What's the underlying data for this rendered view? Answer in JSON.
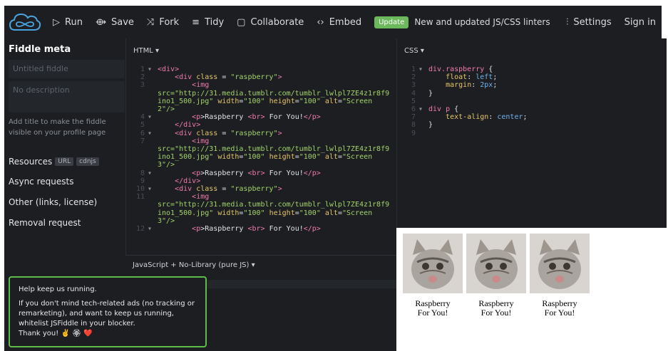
{
  "topbar": {
    "run": "Run",
    "save": "Save",
    "fork": "Fork",
    "tidy": "Tidy",
    "collaborate": "Collaborate",
    "embed": "Embed",
    "update_badge": "Update",
    "news": "New and updated JS/CSS linters",
    "settings": "Settings",
    "sign_in": "Sign in"
  },
  "sidebar": {
    "title": "Fiddle meta",
    "title_placeholder": "Untitled fiddle",
    "description_placeholder": "No description",
    "help": "Add title to make the fiddle visible on your profile page",
    "resources": "Resources",
    "resources_url": "URL",
    "resources_cdnjs": "cdnjs",
    "async": "Async requests",
    "other": "Other (links, license)",
    "removal": "Removal request"
  },
  "html_panel": {
    "header": "HTML ▾"
  },
  "css_panel": {
    "header": "CSS ▾"
  },
  "js_panel": {
    "header": "JavaScript + No-Library (pure JS) ▾"
  },
  "html_code": {
    "img_src_1": "src=\"http://31.media.tumblr.com/tumblr_lwlpl7ZE4z1r8f9",
    "img_src_2": "ino1_500.jpg\"",
    "caption": ">Raspberry ",
    "caption_2": " For You!",
    "alt2": "\"Screen",
    "alt2b": "2\"/>",
    "alt3b": "3\"/>"
  },
  "ad": {
    "line1": "Help keep us running.",
    "line2": "If you don't mind tech-related ads (no tracking or remarketing), and want to keep us running, whitelist JSFiddle in your blocker.",
    "line3": "Thank you! ✌️ 🏵 ❤️"
  },
  "result": {
    "captions": [
      "Raspberry",
      "For You!"
    ]
  },
  "colors": {
    "accent": "#6bb95a",
    "bg": "#1c1e22"
  }
}
